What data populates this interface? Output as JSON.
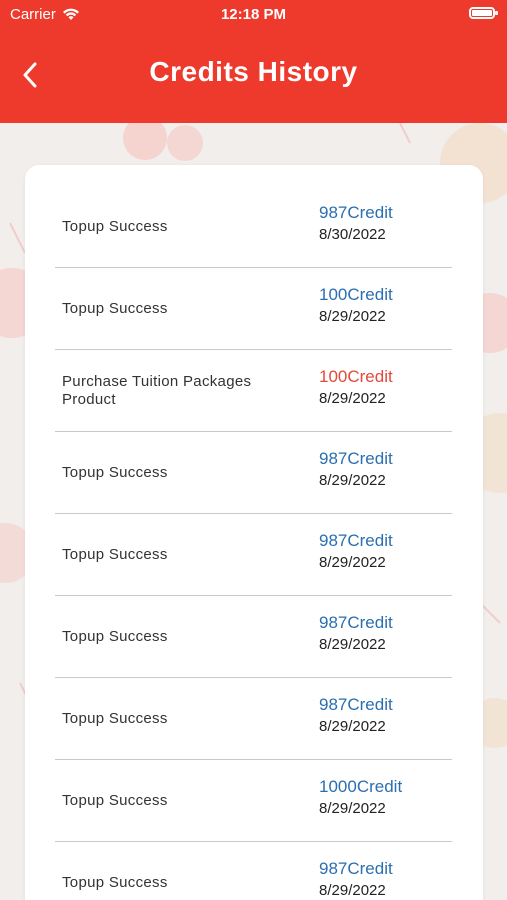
{
  "status_bar": {
    "carrier": "Carrier",
    "time": "12:18 PM"
  },
  "header": {
    "title": "Credits History",
    "back_icon": "chevron-left-icon"
  },
  "colors": {
    "header": "#ed3a2c",
    "credit_positive": "#2a6fb0",
    "credit_negative": "#e5483a"
  },
  "transactions": [
    {
      "description": "Topup Success",
      "credit": "987Credit",
      "date": "8/30/2022",
      "type": "credit"
    },
    {
      "description": "Topup Success",
      "credit": "100Credit",
      "date": "8/29/2022",
      "type": "credit"
    },
    {
      "description": "Purchase Tuition Packages Product",
      "credit": "100Credit",
      "date": "8/29/2022",
      "type": "debit"
    },
    {
      "description": "Topup Success",
      "credit": "987Credit",
      "date": "8/29/2022",
      "type": "credit"
    },
    {
      "description": "Topup Success",
      "credit": "987Credit",
      "date": "8/29/2022",
      "type": "credit"
    },
    {
      "description": "Topup Success",
      "credit": "987Credit",
      "date": "8/29/2022",
      "type": "credit"
    },
    {
      "description": "Topup Success",
      "credit": "987Credit",
      "date": "8/29/2022",
      "type": "credit"
    },
    {
      "description": "Topup Success",
      "credit": "1000Credit",
      "date": "8/29/2022",
      "type": "credit"
    },
    {
      "description": "Topup Success",
      "credit": "987Credit",
      "date": "8/29/2022",
      "type": "credit"
    }
  ]
}
